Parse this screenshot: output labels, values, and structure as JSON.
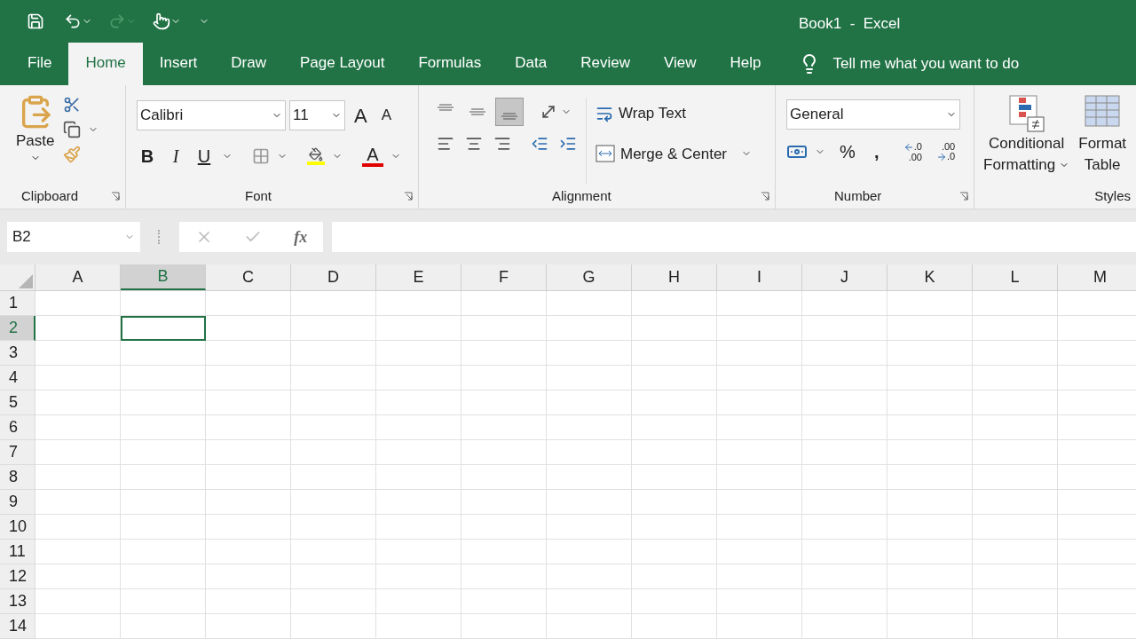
{
  "window": {
    "title": "Book1  -  Excel"
  },
  "quick_access": {
    "redo_disabled": true
  },
  "tabs": [
    {
      "label": "File",
      "selected": false
    },
    {
      "label": "Home",
      "selected": true
    },
    {
      "label": "Insert",
      "selected": false
    },
    {
      "label": "Draw",
      "selected": false
    },
    {
      "label": "Page Layout",
      "selected": false
    },
    {
      "label": "Formulas",
      "selected": false
    },
    {
      "label": "Data",
      "selected": false
    },
    {
      "label": "Review",
      "selected": false
    },
    {
      "label": "View",
      "selected": false
    },
    {
      "label": "Help",
      "selected": false
    }
  ],
  "tell_me": "Tell me what you want to do",
  "clipboard": {
    "paste": "Paste",
    "group": "Clipboard"
  },
  "font": {
    "font_name": "Calibri",
    "font_size": "11",
    "grow": "A",
    "shrink": "A",
    "bold": "B",
    "italic": "I",
    "underline": "U",
    "font_color": "A",
    "group": "Font"
  },
  "alignment": {
    "vertical_align": [
      {
        "selected": false
      },
      {
        "selected": false
      },
      {
        "selected": true
      }
    ],
    "wrap": "Wrap Text",
    "merge": "Merge & Center",
    "group": "Alignment"
  },
  "number": {
    "format": "General",
    "percent": "%",
    "comma": ",",
    "increase_decimal": {
      "top": ".0",
      "bottom": ".00"
    },
    "decrease_decimal": {
      "top": ".00",
      "bottom": ".0"
    },
    "group": "Number"
  },
  "styles": {
    "conditional": [
      "Conditional",
      "Formatting"
    ],
    "format_table": [
      "Format",
      "Table"
    ],
    "group": "Styles"
  },
  "name_box": "B2",
  "fx": "fx",
  "sheet": {
    "columns": [
      {
        "label": "A",
        "selected": false
      },
      {
        "label": "B",
        "selected": true
      },
      {
        "label": "C",
        "selected": false
      },
      {
        "label": "D",
        "selected": false
      },
      {
        "label": "E",
        "selected": false
      },
      {
        "label": "F",
        "selected": false
      },
      {
        "label": "G",
        "selected": false
      },
      {
        "label": "H",
        "selected": false
      },
      {
        "label": "I",
        "selected": false
      },
      {
        "label": "J",
        "selected": false
      },
      {
        "label": "K",
        "selected": false
      },
      {
        "label": "L",
        "selected": false
      },
      {
        "label": "M",
        "selected": false
      }
    ],
    "rows": [
      {
        "label": "1",
        "selected": false
      },
      {
        "label": "2",
        "selected": true
      },
      {
        "label": "3",
        "selected": false
      },
      {
        "label": "4",
        "selected": false
      },
      {
        "label": "5",
        "selected": false
      },
      {
        "label": "6",
        "selected": false
      },
      {
        "label": "7",
        "selected": false
      },
      {
        "label": "8",
        "selected": false
      },
      {
        "label": "9",
        "selected": false
      },
      {
        "label": "10",
        "selected": false
      },
      {
        "label": "11",
        "selected": false
      },
      {
        "label": "12",
        "selected": false
      },
      {
        "label": "13",
        "selected": false
      },
      {
        "label": "14",
        "selected": false
      }
    ]
  }
}
